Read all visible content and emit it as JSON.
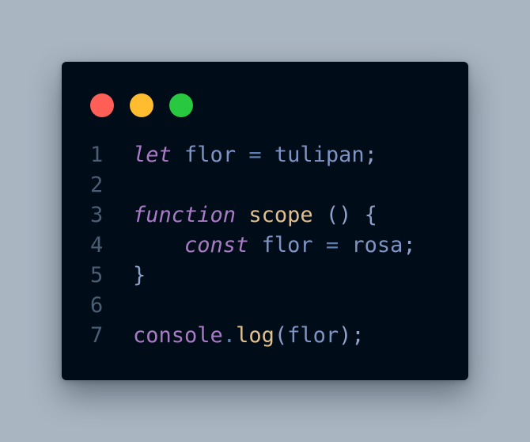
{
  "window": {
    "dots": [
      {
        "name": "close-dot",
        "color": "#ff5f57"
      },
      {
        "name": "minimize-dot",
        "color": "#febc2e"
      },
      {
        "name": "maximize-dot",
        "color": "#28c840"
      }
    ]
  },
  "colors": {
    "keyword": "#a97bc4",
    "identifier": "#7d94c4",
    "function_name": "#e0c08e",
    "object": "#a97bc4",
    "punct": "#8ea2c9",
    "operator": "#5d7fb0",
    "line_number": "#4b5d73"
  },
  "code": {
    "lines": [
      {
        "number": "1",
        "tokens": [
          {
            "t": "let",
            "c": "keyword",
            "i": true
          },
          {
            "t": " ",
            "c": "identifier"
          },
          {
            "t": "flor",
            "c": "identifier"
          },
          {
            "t": " ",
            "c": "identifier"
          },
          {
            "t": "=",
            "c": "operator"
          },
          {
            "t": " ",
            "c": "identifier"
          },
          {
            "t": "tulipan",
            "c": "identifier"
          },
          {
            "t": ";",
            "c": "punct"
          }
        ]
      },
      {
        "number": "2",
        "tokens": []
      },
      {
        "number": "3",
        "tokens": [
          {
            "t": "function",
            "c": "keyword",
            "i": true
          },
          {
            "t": " ",
            "c": "identifier"
          },
          {
            "t": "scope",
            "c": "function_name"
          },
          {
            "t": " ",
            "c": "identifier"
          },
          {
            "t": "()",
            "c": "punct"
          },
          {
            "t": " ",
            "c": "identifier"
          },
          {
            "t": "{",
            "c": "punct"
          }
        ]
      },
      {
        "number": "4",
        "tokens": [
          {
            "t": "    ",
            "c": "identifier"
          },
          {
            "t": "const",
            "c": "keyword",
            "i": true
          },
          {
            "t": " ",
            "c": "identifier"
          },
          {
            "t": "flor",
            "c": "identifier"
          },
          {
            "t": " ",
            "c": "identifier"
          },
          {
            "t": "=",
            "c": "operator"
          },
          {
            "t": " ",
            "c": "identifier"
          },
          {
            "t": "rosa",
            "c": "identifier"
          },
          {
            "t": ";",
            "c": "punct"
          }
        ]
      },
      {
        "number": "5",
        "tokens": [
          {
            "t": "}",
            "c": "punct"
          }
        ]
      },
      {
        "number": "6",
        "tokens": []
      },
      {
        "number": "7",
        "tokens": [
          {
            "t": "console",
            "c": "object"
          },
          {
            "t": ".",
            "c": "operator"
          },
          {
            "t": "log",
            "c": "function_name"
          },
          {
            "t": "(",
            "c": "punct"
          },
          {
            "t": "flor",
            "c": "identifier"
          },
          {
            "t": ")",
            "c": "punct"
          },
          {
            "t": ";",
            "c": "punct"
          }
        ]
      }
    ]
  }
}
